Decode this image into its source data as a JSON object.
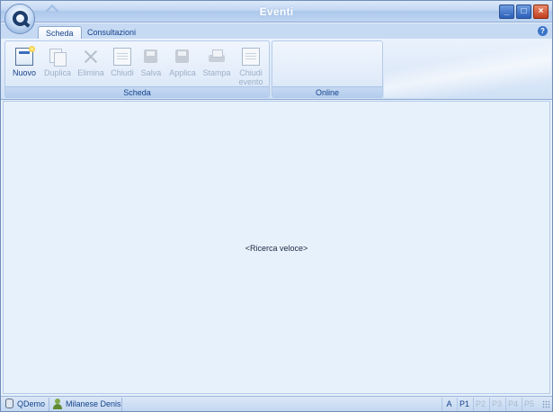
{
  "window": {
    "title": "Eventi"
  },
  "tabs": [
    {
      "label": "Scheda",
      "active": true
    },
    {
      "label": "Consultazioni",
      "active": false
    }
  ],
  "ribbon": {
    "groups": [
      {
        "label": "Scheda"
      },
      {
        "label": "Online"
      }
    ],
    "buttons": [
      {
        "label": "Nuovo",
        "icon": "new-document-icon",
        "enabled": true
      },
      {
        "label": "Duplica",
        "icon": "duplicate-icon",
        "enabled": false
      },
      {
        "label": "Elimina",
        "icon": "delete-x-icon",
        "enabled": false
      },
      {
        "label": "Chiudi",
        "icon": "close-document-icon",
        "enabled": false
      },
      {
        "label": "Salva",
        "icon": "save-icon",
        "enabled": false
      },
      {
        "label": "Applica",
        "icon": "apply-icon",
        "enabled": false
      },
      {
        "label": "Stampa",
        "icon": "print-icon",
        "enabled": false
      },
      {
        "label": "Chiudi evento",
        "icon": "close-event-icon",
        "enabled": false
      }
    ]
  },
  "main": {
    "placeholder": "<Ricerca veloce>"
  },
  "statusbar": {
    "database": "QDemo",
    "user": "Milanese Denis",
    "cells": [
      {
        "label": "A",
        "enabled": true
      },
      {
        "label": "P1",
        "enabled": true
      },
      {
        "label": "P2",
        "enabled": false
      },
      {
        "label": "P3",
        "enabled": false
      },
      {
        "label": "P4",
        "enabled": false
      },
      {
        "label": "P5",
        "enabled": false
      }
    ]
  },
  "colors": {
    "accent": "#15428b",
    "titlebar": "#bfd5f1",
    "background": "#e7f1fc"
  }
}
